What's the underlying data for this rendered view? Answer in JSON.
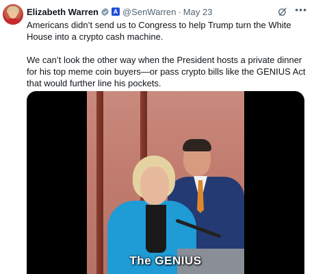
{
  "tweet": {
    "author_name": "Elizabeth Warren",
    "handle": "@SenWarren",
    "separator": "·",
    "date": "May 23",
    "gov_badge": "A",
    "paragraphs": [
      "Americans didn’t send us to Congress to help Trump turn the White House into a crypto cash machine.",
      "We can’t look the other way when the President hosts a private dinner for his top meme coin buyers—or pass crypto bills like the GENIUS Act that would further line his pockets."
    ],
    "more_icon": "•••",
    "icons": {
      "verified": "verified-badge-icon",
      "gov": "government-badge-icon",
      "grok": "grok-icon",
      "more": "more-options-icon"
    }
  },
  "media": {
    "caption": "The GENIUS"
  },
  "colors": {
    "text_primary": "#0f1419",
    "text_secondary": "#536471",
    "verified_blue": "#1d9bf0",
    "gov_badge": "#1d4ed8"
  }
}
